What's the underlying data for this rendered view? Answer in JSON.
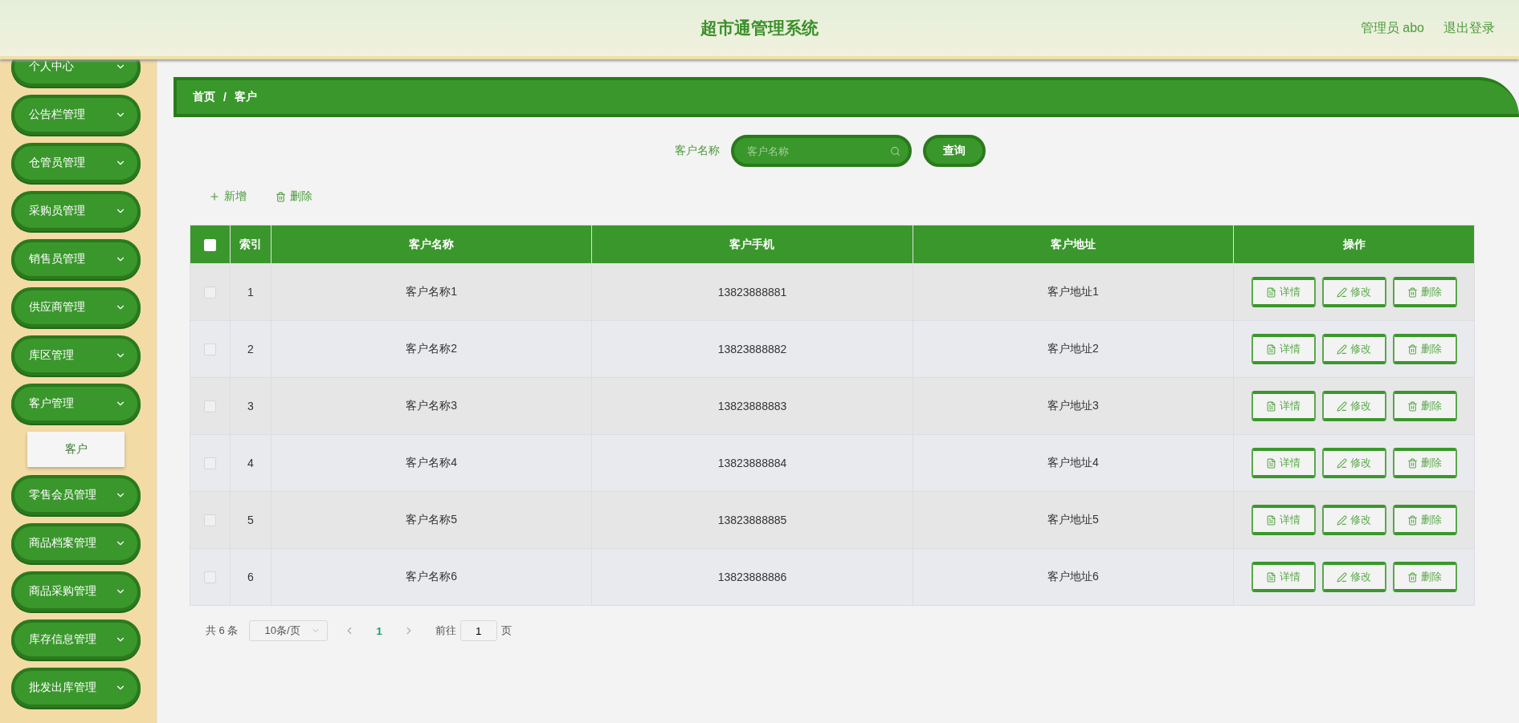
{
  "header": {
    "title": "超市通管理系统",
    "user": "管理员 abo",
    "logout": "退出登录"
  },
  "sidebar": {
    "items": [
      {
        "label": "个人中心"
      },
      {
        "label": "公告栏管理"
      },
      {
        "label": "仓管员管理"
      },
      {
        "label": "采购员管理"
      },
      {
        "label": "销售员管理"
      },
      {
        "label": "供应商管理"
      },
      {
        "label": "库区管理"
      },
      {
        "label": "客户管理",
        "children": [
          {
            "label": "客户",
            "selected": true
          }
        ]
      },
      {
        "label": "零售会员管理"
      },
      {
        "label": "商品档案管理"
      },
      {
        "label": "商品采购管理"
      },
      {
        "label": "库存信息管理"
      },
      {
        "label": "批发出库管理"
      }
    ]
  },
  "breadcrumb": [
    "首页",
    "客户"
  ],
  "breadcrumb_separator": "/",
  "search": {
    "label": "客户名称",
    "placeholder": "客户名称",
    "button": "查询"
  },
  "actions": [
    {
      "kind": "add",
      "label": "新增"
    },
    {
      "kind": "delete",
      "label": "删除"
    }
  ],
  "table": {
    "all_checked": false,
    "columns": [
      "索引",
      "客户名称",
      "客户手机",
      "客户地址",
      "操作"
    ],
    "rows": [
      {
        "checked": false,
        "index": "1",
        "name": "客户名称1",
        "phone": "13823888881",
        "address": "客户地址1",
        "actions": [
          {
            "kind": "detail",
            "label": "详情"
          },
          {
            "kind": "edit",
            "label": "修改"
          },
          {
            "kind": "delete",
            "label": "删除"
          }
        ]
      },
      {
        "checked": false,
        "index": "2",
        "name": "客户名称2",
        "phone": "13823888882",
        "address": "客户地址2",
        "actions": [
          {
            "kind": "detail",
            "label": "详情"
          },
          {
            "kind": "edit",
            "label": "修改"
          },
          {
            "kind": "delete",
            "label": "删除"
          }
        ]
      },
      {
        "checked": false,
        "index": "3",
        "name": "客户名称3",
        "phone": "13823888883",
        "address": "客户地址3",
        "actions": [
          {
            "kind": "detail",
            "label": "详情"
          },
          {
            "kind": "edit",
            "label": "修改"
          },
          {
            "kind": "delete",
            "label": "删除"
          }
        ]
      },
      {
        "checked": false,
        "index": "4",
        "name": "客户名称4",
        "phone": "13823888884",
        "address": "客户地址4",
        "actions": [
          {
            "kind": "detail",
            "label": "详情"
          },
          {
            "kind": "edit",
            "label": "修改"
          },
          {
            "kind": "delete",
            "label": "删除"
          }
        ]
      },
      {
        "checked": false,
        "index": "5",
        "name": "客户名称5",
        "phone": "13823888885",
        "address": "客户地址5",
        "actions": [
          {
            "kind": "detail",
            "label": "详情"
          },
          {
            "kind": "edit",
            "label": "修改"
          },
          {
            "kind": "delete",
            "label": "删除"
          }
        ]
      },
      {
        "checked": false,
        "index": "6",
        "name": "客户名称6",
        "phone": "13823888886",
        "address": "客户地址6",
        "actions": [
          {
            "kind": "detail",
            "label": "详情"
          },
          {
            "kind": "edit",
            "label": "修改"
          },
          {
            "kind": "delete",
            "label": "删除"
          }
        ]
      }
    ]
  },
  "pagination": {
    "total": "共 6 条",
    "page_size": "10条/页",
    "pages": [
      {
        "label": "1",
        "selected": true
      }
    ],
    "goto_label": "前往",
    "goto_value": "1",
    "goto_suffix": "页"
  }
}
